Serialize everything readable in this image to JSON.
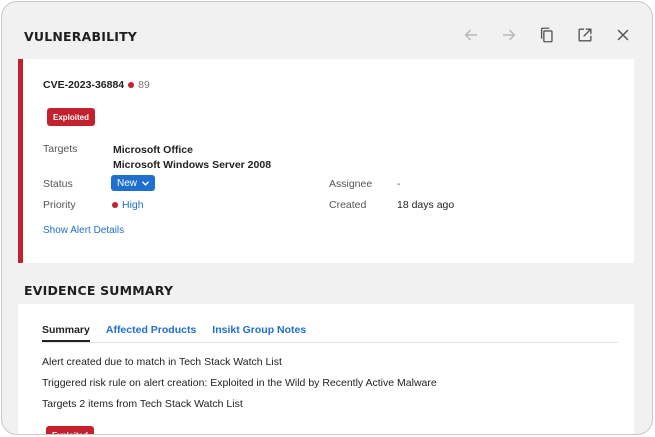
{
  "header": {
    "title": "VULNERABILITY",
    "icons": [
      "arrow-left-icon",
      "arrow-right-icon",
      "copy-icon",
      "external-link-icon",
      "close-icon"
    ]
  },
  "alert": {
    "cve_id": "CVE-2023-36884",
    "risk_score": "89",
    "badge": "Exploited",
    "targets_label": "Targets",
    "targets": [
      "Microsoft Office",
      "Microsoft Windows Server 2008"
    ],
    "status_label": "Status",
    "status_value": "New",
    "priority_label": "Priority",
    "priority_value": "High",
    "assignee_label": "Assignee",
    "assignee_value": "-",
    "created_label": "Created",
    "created_value": "18 days ago",
    "show_details": "Show Alert Details"
  },
  "evidence": {
    "title": "EVIDENCE SUMMARY",
    "tabs": [
      {
        "label": "Summary",
        "active": true
      },
      {
        "label": "Affected Products",
        "active": false
      },
      {
        "label": "Insikt Group Notes",
        "active": false
      }
    ],
    "lines": [
      "Alert created due to match in Tech Stack Watch List",
      "Triggered risk rule on alert creation: Exploited in the Wild by Recently Active Malware",
      "Targets 2 items from Tech Stack Watch List"
    ],
    "badge": "Exploited"
  },
  "colors": {
    "accent_red": "#c4212f",
    "link_blue": "#1f6fcf",
    "background": "#f1f1f1"
  }
}
